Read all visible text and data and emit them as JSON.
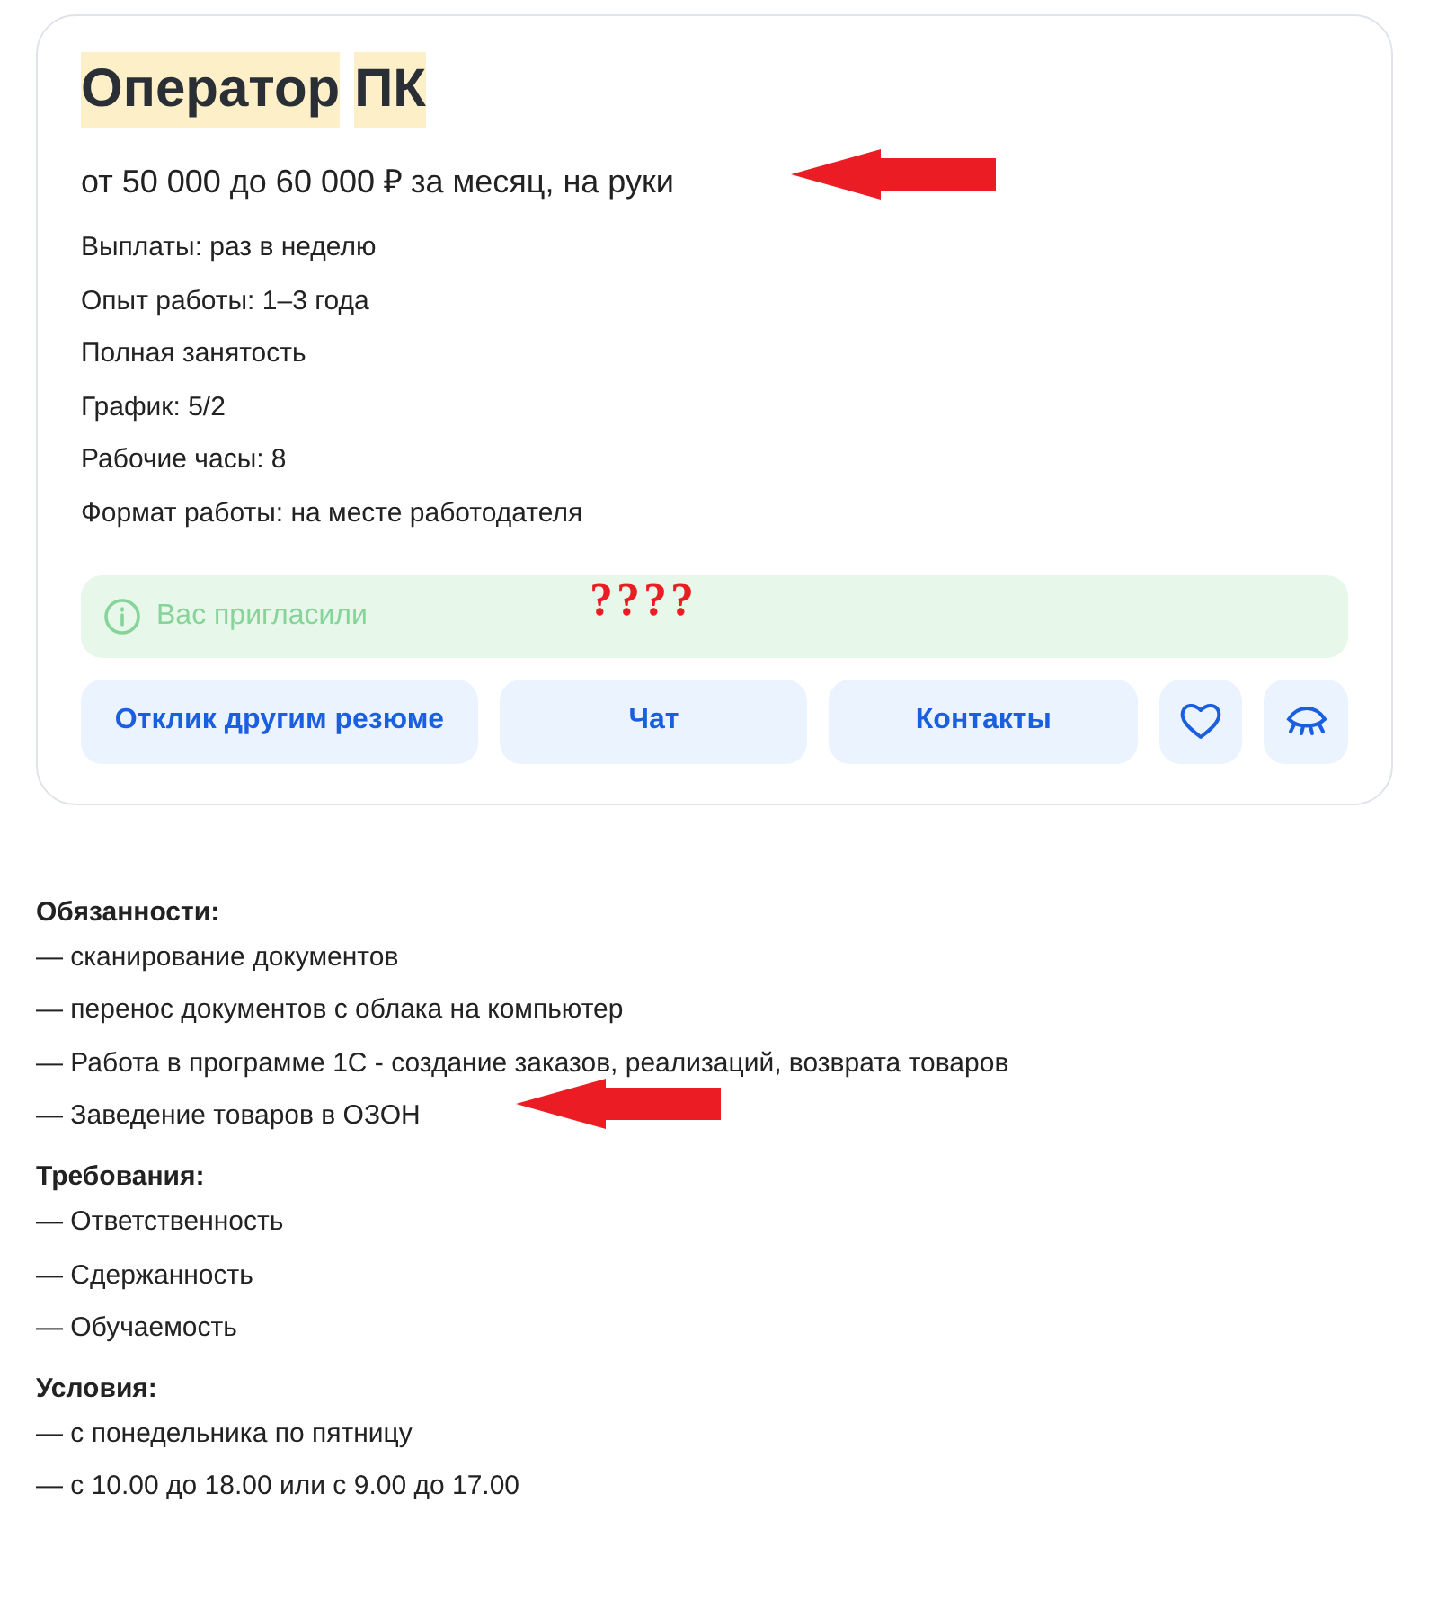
{
  "vacancy": {
    "title_words": [
      {
        "text": "Оператор",
        "highlighted": true
      },
      {
        "text": "ПК",
        "highlighted": true
      }
    ],
    "salary": "от 50 000 до 60 000 ₽ за месяц, на руки",
    "details": [
      "Выплаты: раз в неделю",
      "Опыт работы: 1–3 года",
      "Полная занятость",
      "График: 5/2",
      "Рабочие часы: 8",
      "Формат работы: на месте работодателя"
    ],
    "status": "Вас пригласили",
    "buttons": [
      {
        "kind": "text",
        "label": "Отклик другим резюме"
      },
      {
        "kind": "text",
        "label": "Чат"
      },
      {
        "kind": "text",
        "label": "Контакты"
      },
      {
        "kind": "heart"
      },
      {
        "kind": "eye"
      }
    ]
  },
  "description": [
    {
      "heading": "Обязанности:",
      "items": [
        "— сканирование документов",
        "— перенос документов с облака на компьютер",
        "— Работа в программе 1С - создание заказов, реализаций, возврата товаров",
        "— Заведение товаров в ОЗОН"
      ]
    },
    {
      "heading": "Требования:",
      "items": [
        "— Ответственность",
        "— Сдержанность",
        "— Обучаемость"
      ]
    },
    {
      "heading": "Условия:",
      "items": [
        "— с понедельника по пятницу",
        "— с 10.00 до 18.00 или с 9.00 до 17.00"
      ]
    }
  ],
  "annotations": {
    "question_marks": "????"
  }
}
